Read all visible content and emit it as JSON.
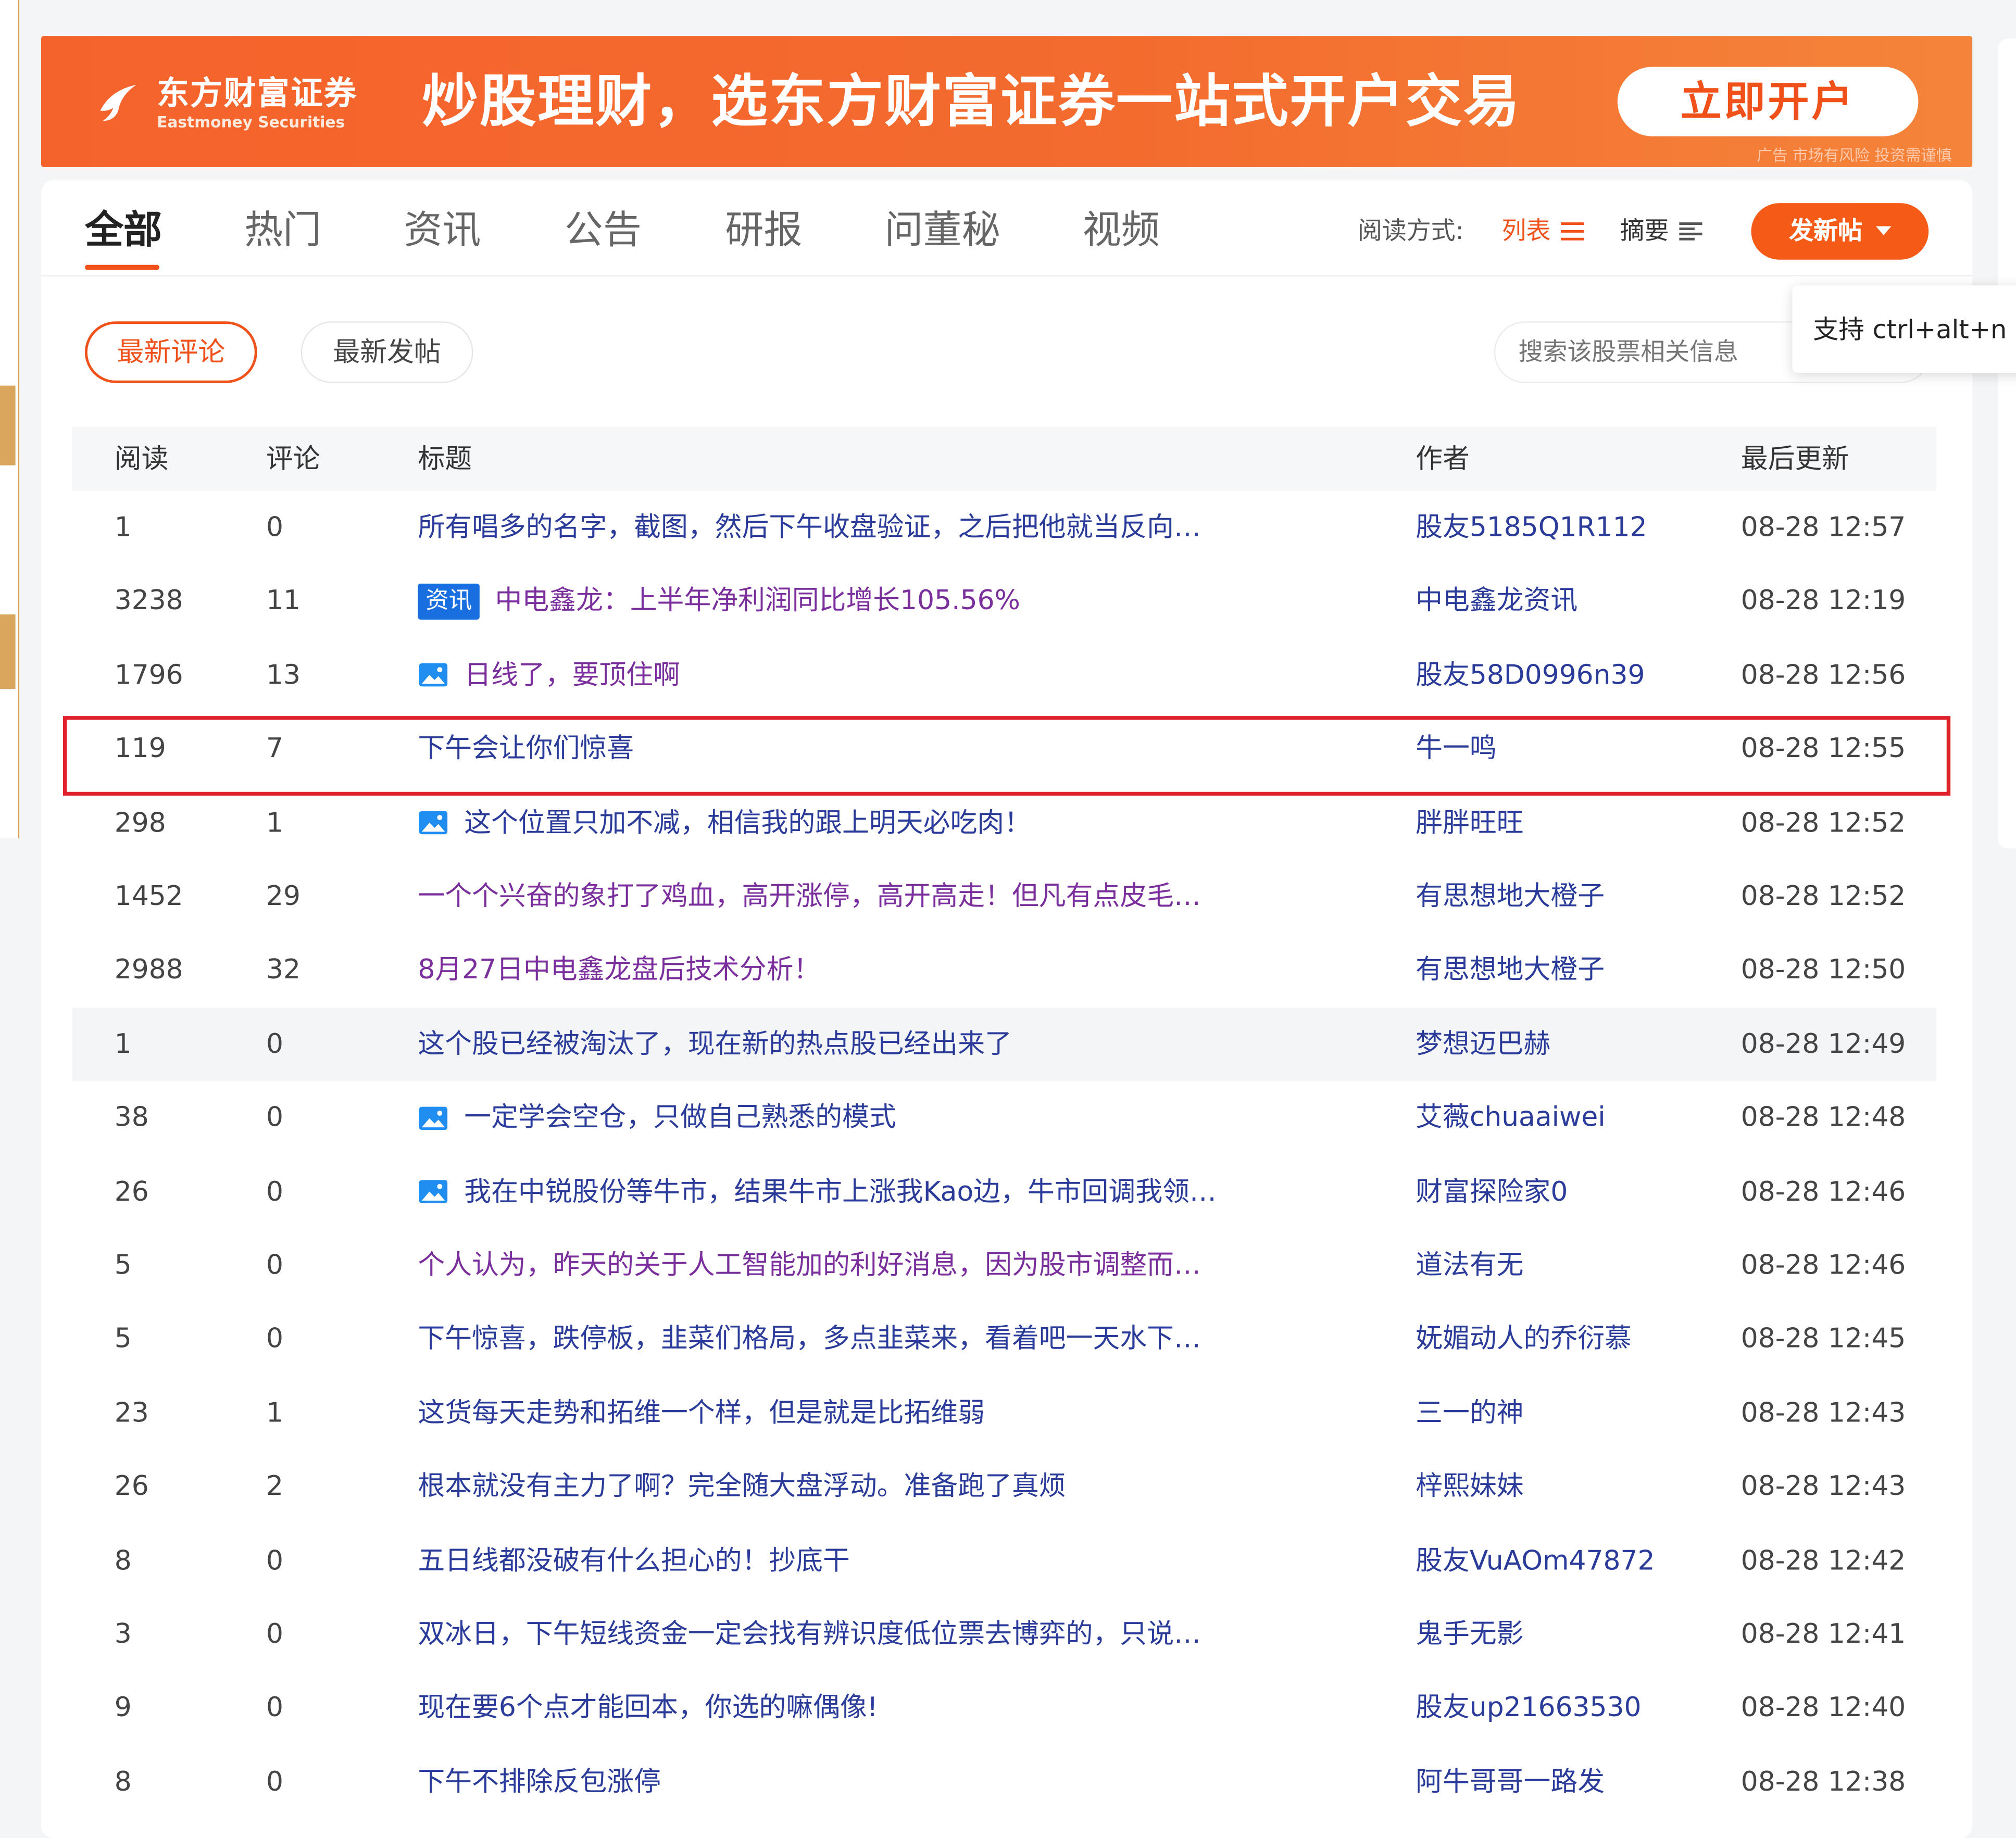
{
  "banner": {
    "logo_cn": "东方财富证券",
    "logo_en": "Eastmoney Securities",
    "slogan": "炒股理财，选东方财富证券一站式开户交易",
    "cta": "立即开户",
    "disclaimer": "广告 市场有风险 投资需谨慎"
  },
  "tabs": [
    "全部",
    "热门",
    "资讯",
    "公告",
    "研报",
    "问董秘",
    "视频"
  ],
  "active_tab": "全部",
  "read_mode": {
    "label": "阅读方式:",
    "list": "列表",
    "summary": "摘要"
  },
  "new_post": "发新帖",
  "tooltip": "支持 ctrl+alt+n",
  "filters": {
    "latest_comment": "最新评论",
    "latest_post": "最新发帖"
  },
  "search": {
    "placeholder": "搜索该股票相关信息"
  },
  "table": {
    "headers": {
      "read": "阅读",
      "comment": "评论",
      "title": "标题",
      "author": "作者",
      "updated": "最后更新"
    },
    "rows": [
      {
        "read": "1",
        "comment": "0",
        "title": "所有唱多的名字，截图，然后下午收盘验证，之后把他就当反向…",
        "author": "股友5185Q1R112",
        "time": "08-28 12:57",
        "tag": "",
        "pic": false,
        "visited": false
      },
      {
        "read": "3238",
        "comment": "11",
        "title": "中电鑫龙：上半年净利润同比增长105.56%",
        "author": "中电鑫龙资讯",
        "time": "08-28 12:19",
        "tag": "资讯",
        "pic": false,
        "visited": true
      },
      {
        "read": "1796",
        "comment": "13",
        "title": "日线了，要顶住啊",
        "author": "股友58D0996n39",
        "time": "08-28 12:56",
        "tag": "",
        "pic": true,
        "visited": true
      },
      {
        "read": "119",
        "comment": "7",
        "title": "下午会让你们惊喜",
        "author": "牛一鸣",
        "time": "08-28 12:55",
        "tag": "",
        "pic": false,
        "visited": false
      },
      {
        "read": "298",
        "comment": "1",
        "title": "这个位置只加不减，相信我的跟上明天必吃肉！",
        "author": "胖胖旺旺",
        "time": "08-28 12:52",
        "tag": "",
        "pic": true,
        "visited": false
      },
      {
        "read": "1452",
        "comment": "29",
        "title": "一个个兴奋的象打了鸡血，高开涨停，高开高走！但凡有点皮毛…",
        "author": "有思想地大橙子",
        "time": "08-28 12:52",
        "tag": "",
        "pic": false,
        "visited": true
      },
      {
        "read": "2988",
        "comment": "32",
        "title": "8月27日中电鑫龙盘后技术分析！",
        "author": "有思想地大橙子",
        "time": "08-28 12:50",
        "tag": "",
        "pic": false,
        "visited": true
      },
      {
        "read": "1",
        "comment": "0",
        "title": "这个股已经被淘汰了，现在新的热点股已经出来了",
        "author": "梦想迈巴赫",
        "time": "08-28 12:49",
        "tag": "",
        "pic": false,
        "visited": false
      },
      {
        "read": "38",
        "comment": "0",
        "title": "一定学会空仓，只做自己熟悉的模式",
        "author": "艾薇chuaaiwei",
        "time": "08-28 12:48",
        "tag": "",
        "pic": true,
        "visited": false
      },
      {
        "read": "26",
        "comment": "0",
        "title": "我在中锐股份等牛市，结果牛市上涨我Kao边，牛市回调我领…",
        "author": "财富探险家0",
        "time": "08-28 12:46",
        "tag": "",
        "pic": true,
        "visited": false
      },
      {
        "read": "5",
        "comment": "0",
        "title": "个人认为，昨天的关于人工智能加的利好消息，因为股市调整而…",
        "author": "道法有无",
        "time": "08-28 12:46",
        "tag": "",
        "pic": false,
        "visited": true
      },
      {
        "read": "5",
        "comment": "0",
        "title": "下午惊喜，跌停板，韭菜们格局，多点韭菜来，看着吧一天水下…",
        "author": "妩媚动人的乔衍慕",
        "time": "08-28 12:45",
        "tag": "",
        "pic": false,
        "visited": false
      },
      {
        "read": "23",
        "comment": "1",
        "title": "这货每天走势和拓维一个样，但是就是比拓维弱",
        "author": "三一的神",
        "time": "08-28 12:43",
        "tag": "",
        "pic": false,
        "visited": false
      },
      {
        "read": "26",
        "comment": "2",
        "title": "根本就没有主力了啊？完全随大盘浮动。准备跑了真烦",
        "author": "梓熙妹妹",
        "time": "08-28 12:43",
        "tag": "",
        "pic": false,
        "visited": false
      },
      {
        "read": "8",
        "comment": "0",
        "title": "五日线都没破有什么担心的！抄底干",
        "author": "股友VuAOm47872",
        "time": "08-28 12:42",
        "tag": "",
        "pic": false,
        "visited": false
      },
      {
        "read": "3",
        "comment": "0",
        "title": "双冰日，下午短线资金一定会找有辨识度低位票去博弈的，只说…",
        "author": "鬼手无影",
        "time": "08-28 12:41",
        "tag": "",
        "pic": false,
        "visited": false
      },
      {
        "read": "9",
        "comment": "0",
        "title": "现在要6个点才能回本，你选的嘛偶像!",
        "author": "股友up21663530",
        "time": "08-28 12:40",
        "tag": "",
        "pic": false,
        "visited": false
      },
      {
        "read": "8",
        "comment": "0",
        "title": "下午不排除反包涨停",
        "author": "阿牛哥哥一路发",
        "time": "08-28 12:38",
        "tag": "",
        "pic": false,
        "visited": false
      }
    ]
  },
  "colors": {
    "accent": "#f0511a",
    "link": "#2a3b9a",
    "visited": "#7a2f9c",
    "highlight": "#e0202a",
    "tag_news": "#1a6fe0"
  }
}
